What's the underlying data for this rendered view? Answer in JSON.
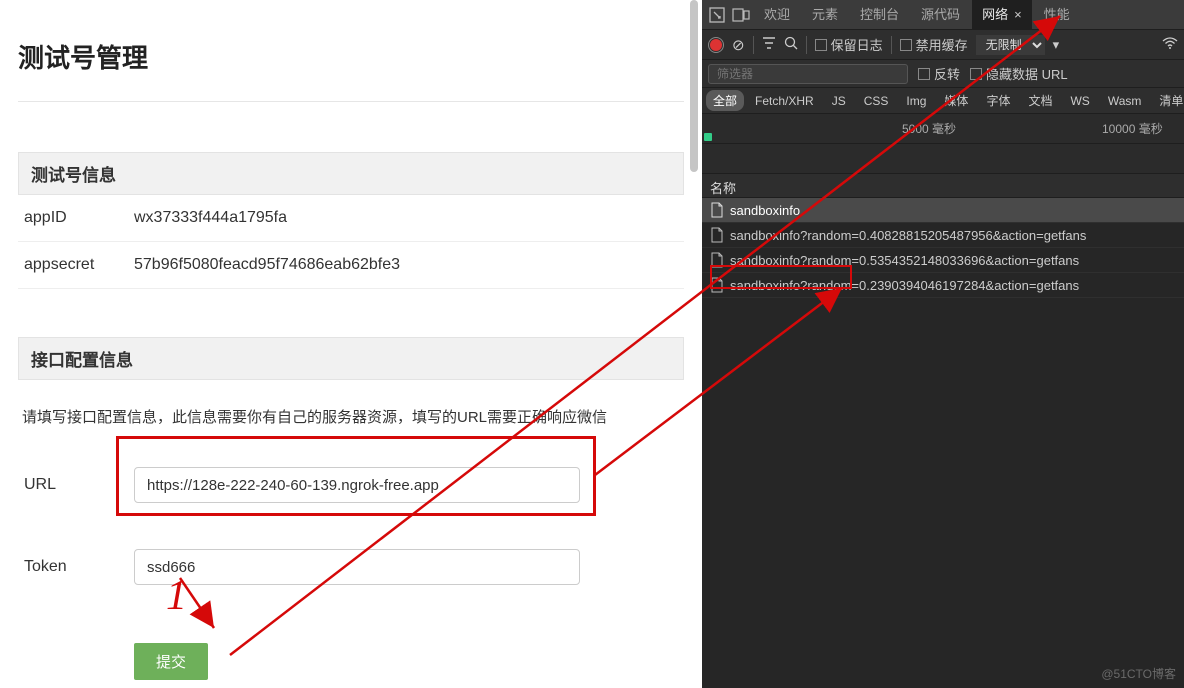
{
  "left": {
    "page_title": "测试号管理",
    "section1_title": "测试号信息",
    "appid_label": "appID",
    "appid_value": "wx37333f444a1795fa",
    "appsecret_label": "appsecret",
    "appsecret_value": "57b96f5080feacd95f74686eab62bfe3",
    "section2_title": "接口配置信息",
    "hint": "请填写接口配置信息，此信息需要你有自己的服务器资源，填写的URL需要正确响应微信",
    "url_label": "URL",
    "url_value": "https://128e-222-240-60-139.ngrok-free.app",
    "token_label": "Token",
    "token_value": "ssd666",
    "submit_label": "提交",
    "annotation_num": "1"
  },
  "devtools": {
    "tabs": {
      "welcome": "欢迎",
      "elements": "元素",
      "console": "控制台",
      "sources": "源代码",
      "network": "网络",
      "performance": "性能"
    },
    "toolbar": {
      "preserve_log": "保留日志",
      "disable_cache": "禁用缓存",
      "throttling": "无限制"
    },
    "filter": {
      "placeholder": "筛选器",
      "invert": "反转",
      "hide_data_urls": "隐藏数据 URL"
    },
    "types": {
      "all": "全部",
      "fetch_xhr": "Fetch/XHR",
      "js": "JS",
      "css": "CSS",
      "img": "Img",
      "media": "媒体",
      "font": "字体",
      "doc": "文档",
      "ws": "WS",
      "wasm": "Wasm",
      "manifest": "清单"
    },
    "timeline": {
      "tick_5000": "5000  毫秒",
      "tick_10000": "10000  毫秒"
    },
    "columns": {
      "name": "名称"
    },
    "requests": [
      "sandboxinfo",
      "sandboxinfo?random=0.40828815205487956&action=getfans",
      "sandboxinfo?random=0.5354352148033696&action=getfans",
      "sandboxinfo?random=0.2390394046197284&action=getfans"
    ],
    "watermark": "@51CTO博客"
  }
}
